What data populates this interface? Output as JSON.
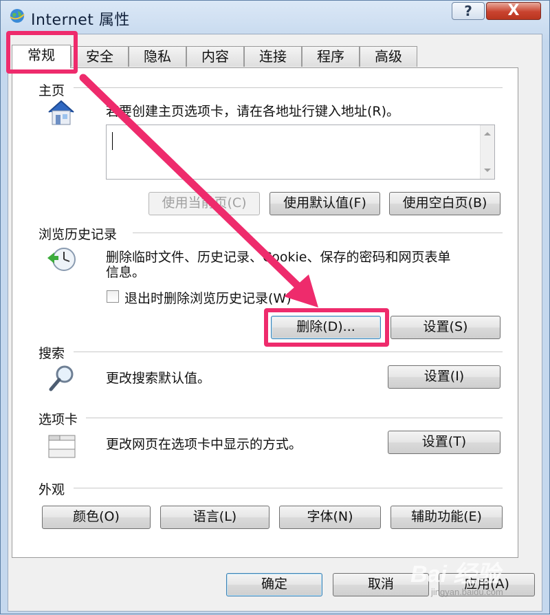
{
  "window": {
    "title": "Internet 属性",
    "help_label": "?",
    "close_label": "X"
  },
  "tabs": [
    "常规",
    "安全",
    "隐私",
    "内容",
    "连接",
    "程序",
    "高级"
  ],
  "homepage": {
    "section_label": "主页",
    "instruction": "若要创建主页选项卡，请在各地址行键入地址(R)。",
    "address_value": "",
    "btn_current": "使用当前页(C)",
    "btn_default": "使用默认值(F)",
    "btn_blank": "使用空白页(B)"
  },
  "history": {
    "section_label": "浏览历史记录",
    "description_line1": "删除临时文件、历史记录、Cookie、保存的密码和网页表单",
    "description_line2": "信息。",
    "checkbox_label": "退出时删除浏览历史记录(W)",
    "checkbox_checked": false,
    "btn_delete": "删除(D)...",
    "btn_settings": "设置(S)"
  },
  "search": {
    "section_label": "搜索",
    "description": "更改搜索默认值。",
    "btn_settings": "设置(I)"
  },
  "tabs_section": {
    "section_label": "选项卡",
    "description": "更改网页在选项卡中显示的方式。",
    "btn_settings": "设置(T)"
  },
  "appearance": {
    "section_label": "外观",
    "btn_colors": "颜色(O)",
    "btn_languages": "语言(L)",
    "btn_fonts": "字体(N)",
    "btn_accessibility": "辅助功能(E)"
  },
  "footer": {
    "btn_ok": "确定",
    "btn_cancel": "取消",
    "btn_apply": "应用(A)"
  },
  "watermark": {
    "text": "Bai 经验",
    "sub": "jingyan.baidu.com"
  },
  "colors": {
    "highlight": "#ee2b6c",
    "titlebar": "#c5d8ee",
    "close": "#c9432f"
  }
}
